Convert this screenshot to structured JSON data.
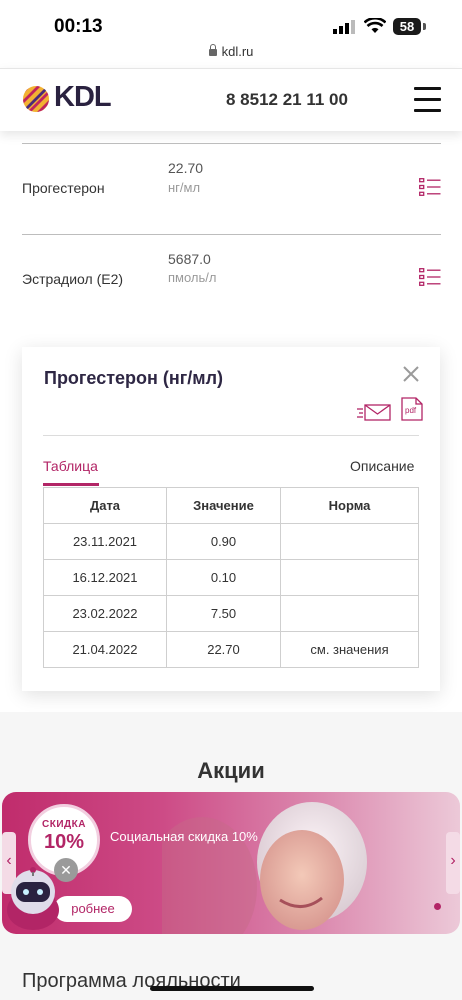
{
  "status_bar": {
    "time": "00:13",
    "battery": "58"
  },
  "browser": {
    "url": "kdl.ru"
  },
  "header": {
    "logo": "KDL",
    "phone": "8 8512 21 11 00"
  },
  "results": [
    {
      "name": "Прогестерон",
      "value": "22.70",
      "unit": "нг/мл"
    },
    {
      "name": "Эстрадиол (Е2)",
      "value": "5687.0",
      "unit": "пмоль/л"
    }
  ],
  "modal": {
    "title": "Прогестерон (нг/мл)",
    "tabs": [
      {
        "label": "Таблица",
        "active": true
      },
      {
        "label": "Описание",
        "active": false
      }
    ],
    "table": {
      "headers": [
        "Дата",
        "Значение",
        "Норма"
      ],
      "rows": [
        [
          "23.11.2021",
          "0.90",
          ""
        ],
        [
          "16.12.2021",
          "0.10",
          ""
        ],
        [
          "23.02.2022",
          "7.50",
          ""
        ],
        [
          "21.04.2022",
          "22.70",
          "см. значения"
        ]
      ]
    },
    "pdf_label": "pdf"
  },
  "promotions": {
    "title": "Акции",
    "banner": {
      "badge_top": "СКИДКА",
      "badge_value": "10%",
      "caption": "Социальная скидка 10%",
      "button": "робнее"
    }
  },
  "loyalty_title": "Программа лояльности",
  "colors": {
    "accent": "#b22566",
    "dark": "#2e2744"
  }
}
